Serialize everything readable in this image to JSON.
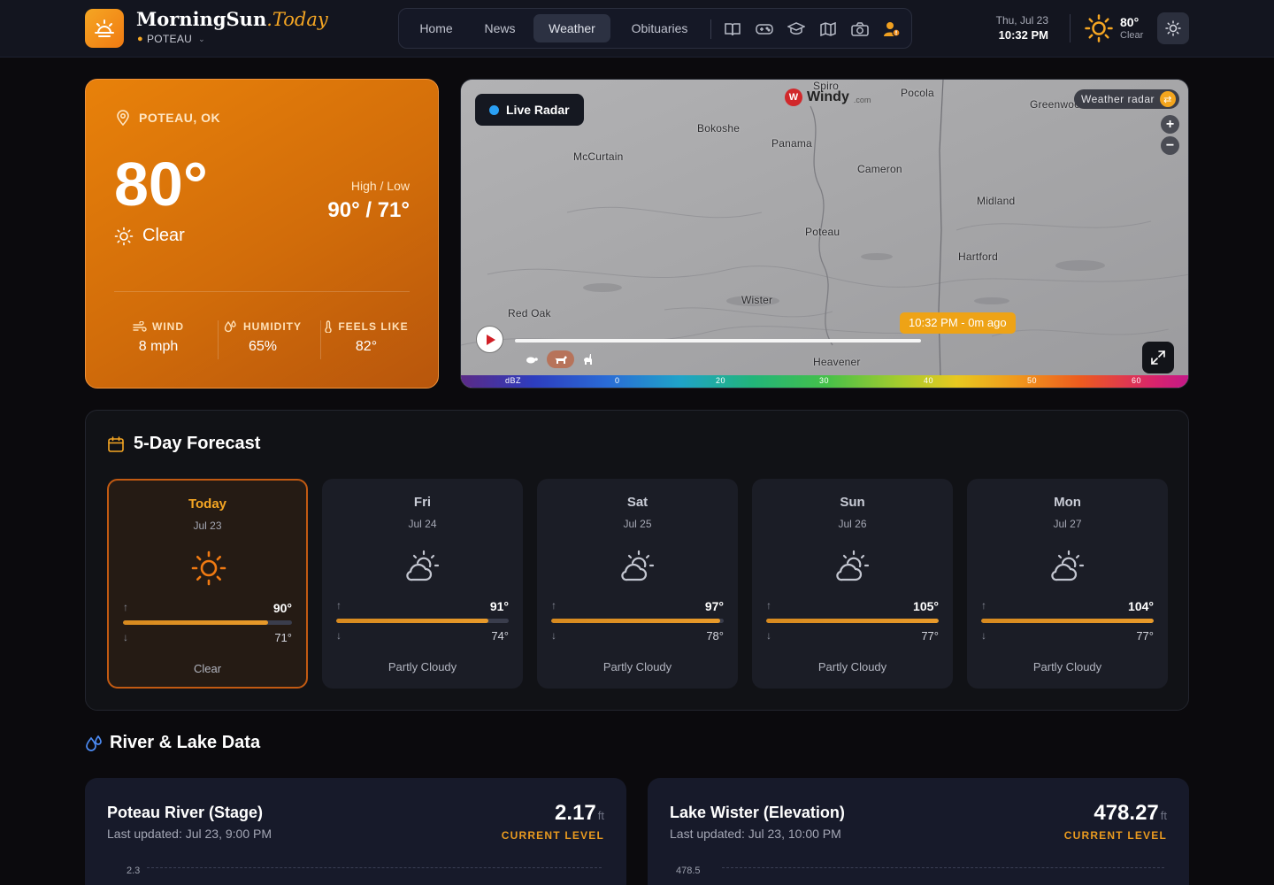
{
  "brand": {
    "name": "MorningSun",
    "suffix": ".Today",
    "location": "POTEAU"
  },
  "nav": {
    "items": [
      "Home",
      "News",
      "Weather",
      "Obituaries"
    ],
    "active": "Weather",
    "icons": [
      "book-icon",
      "gamepad-icon",
      "graduation-cap-icon",
      "map-icon",
      "camera-icon",
      "user-alert-icon"
    ]
  },
  "header": {
    "date": "Thu, Jul 23",
    "time": "10:32 PM",
    "temp": "80°",
    "condition": "Clear"
  },
  "current": {
    "location": "POTEAU, OK",
    "temp": "80°",
    "condition": "Clear",
    "high_low_label": "High / Low",
    "high_low": "90° / 71°",
    "wind_label": "WIND",
    "wind": "8 mph",
    "humidity_label": "HUMIDITY",
    "humidity": "65%",
    "feels_label": "FEELS LIKE",
    "feels": "82°"
  },
  "map": {
    "live_label": "Live Radar",
    "provider": "Windy",
    "provider_suffix": ".com",
    "layer": "Weather radar",
    "time_label": "10:32 PM - 0m ago",
    "cities": [
      "Spiro",
      "Pocola",
      "Greenwood",
      "Bokoshe",
      "Panama",
      "McCurtain",
      "Cameron",
      "Midland",
      "Poteau",
      "Hartford",
      "Wister",
      "Red Oak",
      "Heavener"
    ],
    "scale_unit": "dBZ",
    "scale": [
      "0",
      "20",
      "30",
      "40",
      "50",
      "60"
    ],
    "accent": "#eea316"
  },
  "forecast": {
    "title": "5-Day Forecast",
    "days": [
      {
        "name": "Today",
        "date": "Jul 23",
        "hi": "90°",
        "lo": "71°",
        "cond": "Clear",
        "fill": 0.86,
        "icon": "sun-icon"
      },
      {
        "name": "Fri",
        "date": "Jul 24",
        "hi": "91°",
        "lo": "74°",
        "cond": "Partly Cloudy",
        "fill": 0.88,
        "icon": "partly-cloudy-icon"
      },
      {
        "name": "Sat",
        "date": "Jul 25",
        "hi": "97°",
        "lo": "78°",
        "cond": "Partly Cloudy",
        "fill": 0.98,
        "icon": "partly-cloudy-icon"
      },
      {
        "name": "Sun",
        "date": "Jul 26",
        "hi": "105°",
        "lo": "77°",
        "cond": "Partly Cloudy",
        "fill": 1.0,
        "icon": "partly-cloudy-icon"
      },
      {
        "name": "Mon",
        "date": "Jul 27",
        "hi": "104°",
        "lo": "77°",
        "cond": "Partly Cloudy",
        "fill": 1.0,
        "icon": "partly-cloudy-icon"
      }
    ]
  },
  "river": {
    "title": "River & Lake Data",
    "cards": [
      {
        "title": "Poteau River (Stage)",
        "updated": "Last updated: Jul 23, 9:00 PM",
        "value": "2.17",
        "unit": "ft",
        "label": "CURRENT LEVEL",
        "axis": "2.3"
      },
      {
        "title": "Lake Wister (Elevation)",
        "updated": "Last updated: Jul 23, 10:00 PM",
        "value": "478.27",
        "unit": "ft",
        "label": "CURRENT LEVEL",
        "axis": "478.5"
      }
    ]
  },
  "colors": {
    "accent": "#f5a623",
    "card_orange": "#e8810a",
    "bg": "#0b0a0d"
  }
}
